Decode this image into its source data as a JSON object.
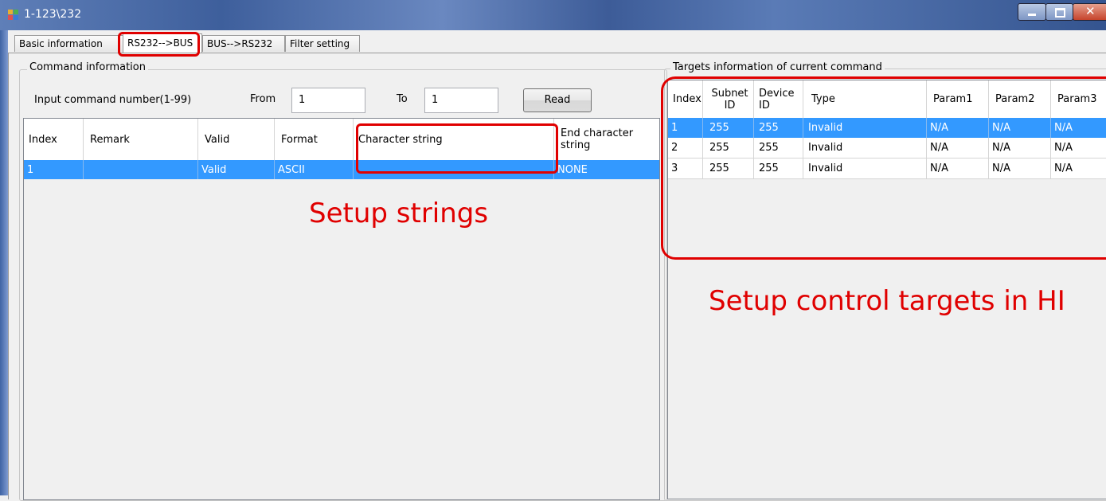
{
  "window": {
    "title": "1-123\\232",
    "accent": "#3e5f9c"
  },
  "tabs": [
    {
      "label": "Basic information"
    },
    {
      "label": "RS232-->BUS"
    },
    {
      "label": "BUS-->RS232"
    },
    {
      "label": "Filter setting"
    }
  ],
  "active_tab": "RS232-->BUS",
  "command_info": {
    "group_label": "Command information",
    "input_label": "Input command number(1-99)",
    "from_label": "From",
    "from_value": "1",
    "to_label": "To",
    "to_value": "1",
    "read_button": "Read",
    "columns": [
      "Index",
      "Remark",
      "Valid",
      "Format",
      "Character string",
      "End character string"
    ],
    "rows": [
      {
        "index": "1",
        "remark": "",
        "valid": "Valid",
        "format": "ASCII",
        "char_string": "",
        "end_string": "NONE",
        "selected": true
      }
    ]
  },
  "targets_info": {
    "group_label": "Targets information of current command",
    "columns": [
      "Index",
      "Subnet ID",
      "Device ID",
      "Type",
      "Param1",
      "Param2",
      "Param3"
    ],
    "rows": [
      {
        "index": "1",
        "subnet": "255",
        "device": "255",
        "type": "Invalid",
        "p1": "N/A",
        "p2": "N/A",
        "p3": "N/A",
        "selected": true
      },
      {
        "index": "2",
        "subnet": "255",
        "device": "255",
        "type": "Invalid",
        "p1": "N/A",
        "p2": "N/A",
        "p3": "N/A",
        "selected": false
      },
      {
        "index": "3",
        "subnet": "255",
        "device": "255",
        "type": "Invalid",
        "p1": "N/A",
        "p2": "N/A",
        "p3": "N/A",
        "selected": false
      }
    ]
  },
  "annotations": {
    "setup_strings": "Setup strings",
    "setup_targets": "Setup control targets in HI",
    "color": "#e00000"
  }
}
